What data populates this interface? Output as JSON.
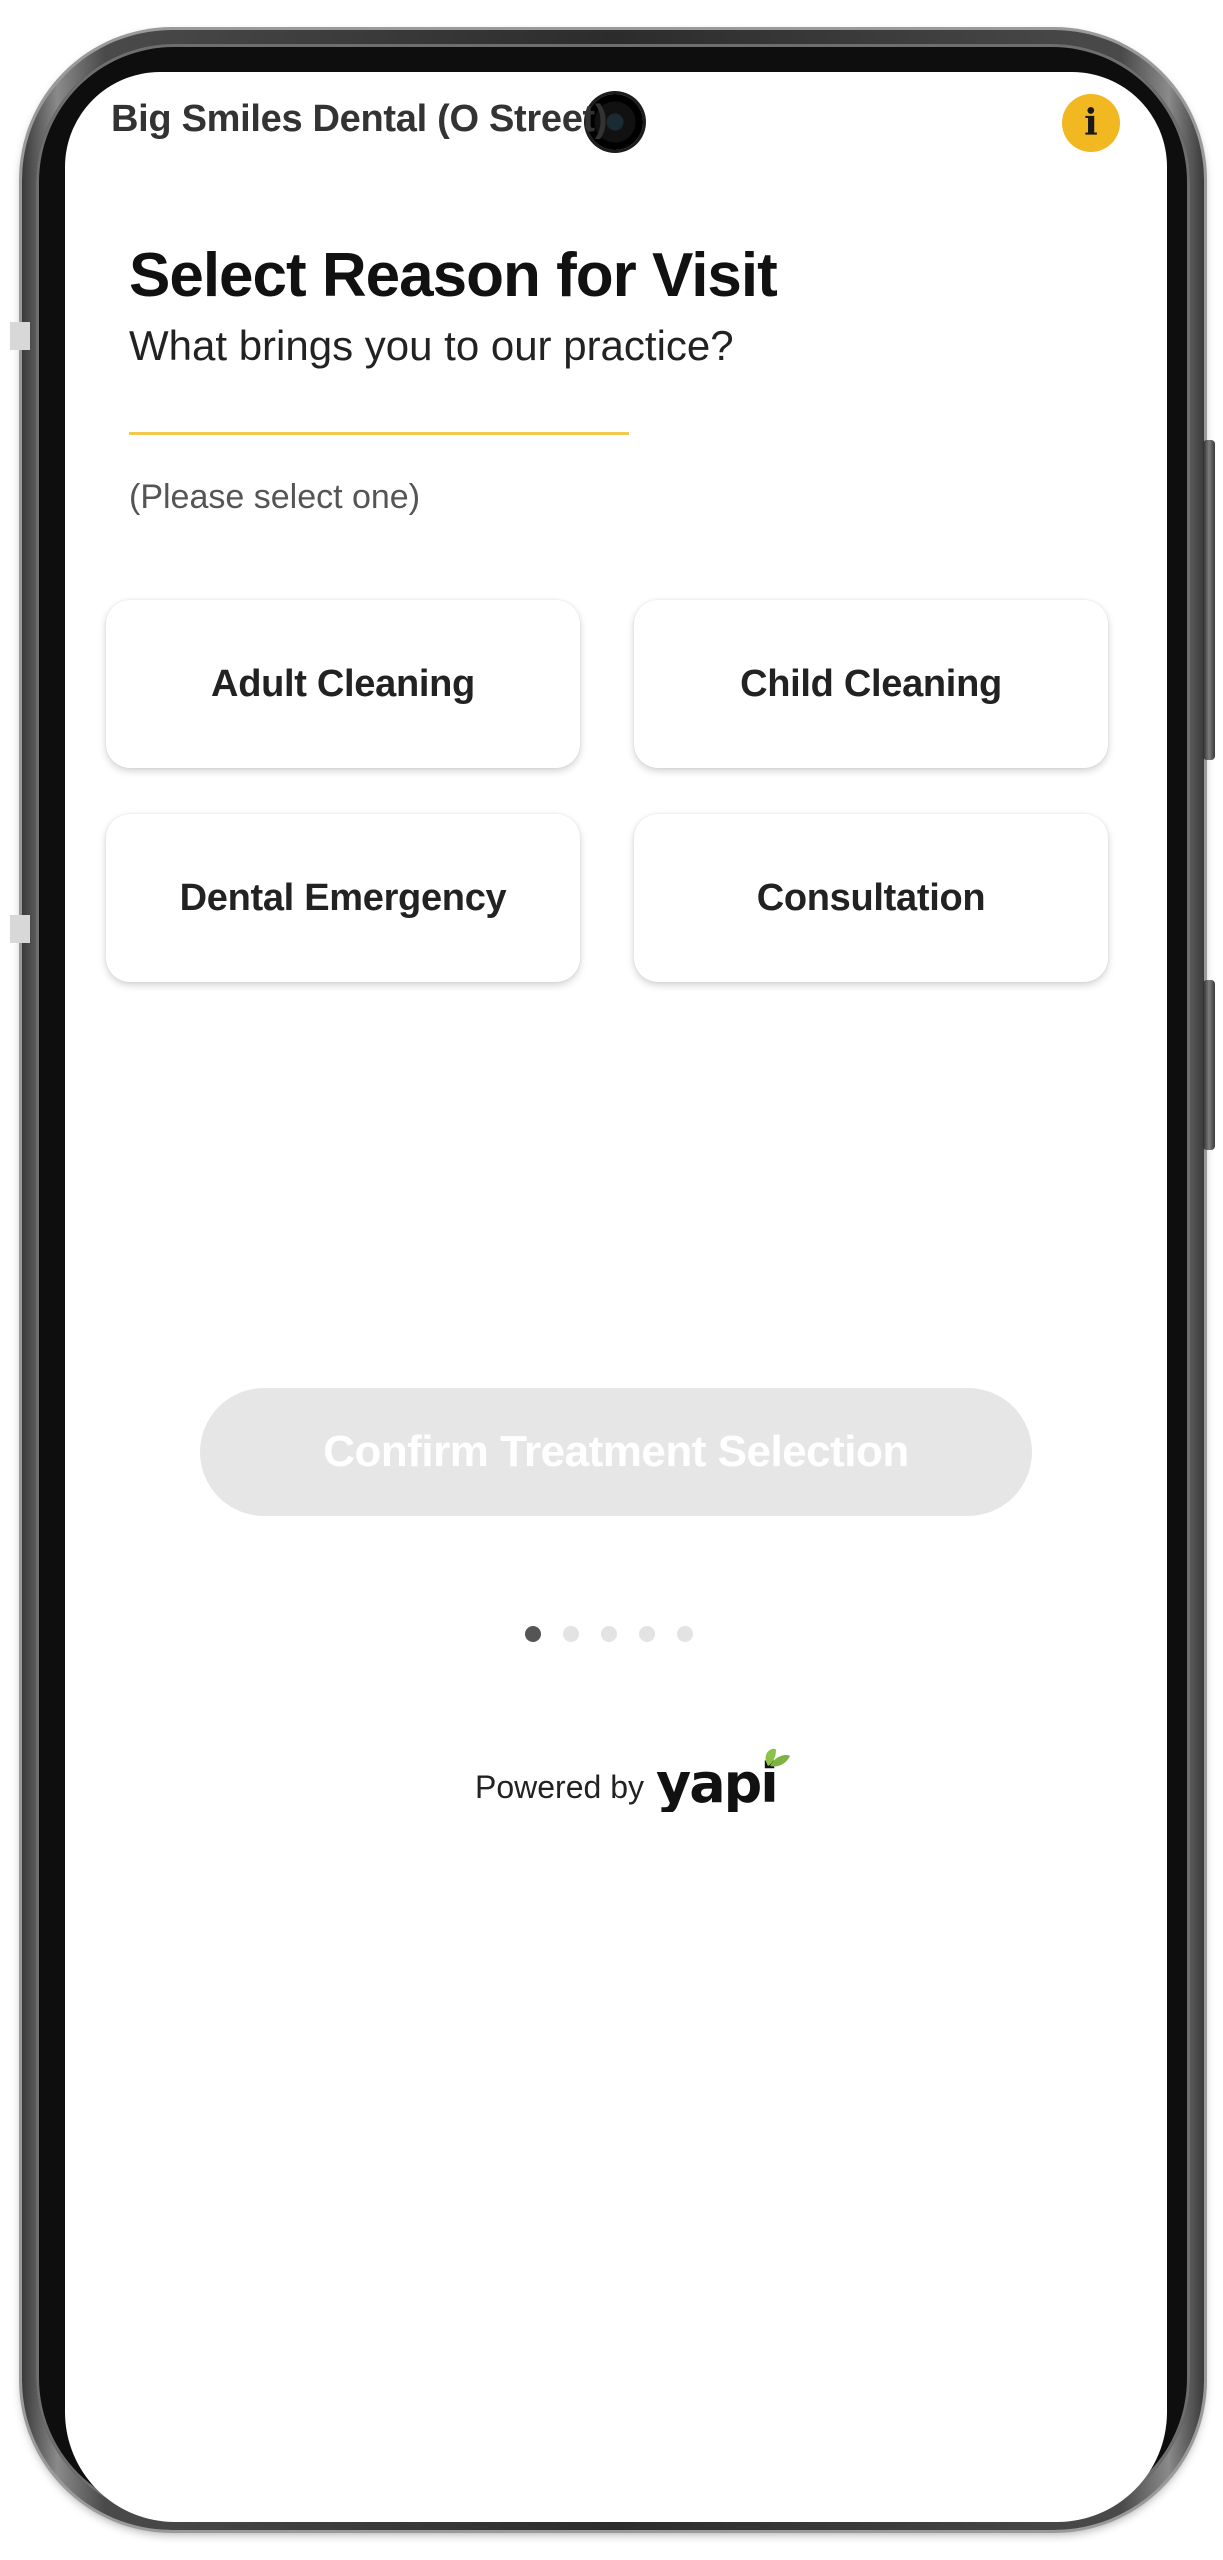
{
  "app": {
    "practice_name": "Big Smiles Dental (O Street)",
    "info_icon": "info-icon",
    "info_glyph": "i",
    "accent_color": "#f2b822"
  },
  "page": {
    "title": "Select Reason for Visit",
    "subtitle": "What brings you to our practice?",
    "hint": "(Please select one)"
  },
  "options": [
    {
      "label": "Adult Cleaning"
    },
    {
      "label": "Child Cleaning"
    },
    {
      "label": "Dental Emergency"
    },
    {
      "label": "Consultation"
    }
  ],
  "confirm": {
    "label": "Confirm Treatment Selection",
    "enabled": false
  },
  "pager": {
    "total_steps": 5,
    "current_step": 1
  },
  "footer": {
    "powered_by_label": "Powered by",
    "brand": "yapi",
    "brand_leaf_color": "#8bc34a"
  }
}
